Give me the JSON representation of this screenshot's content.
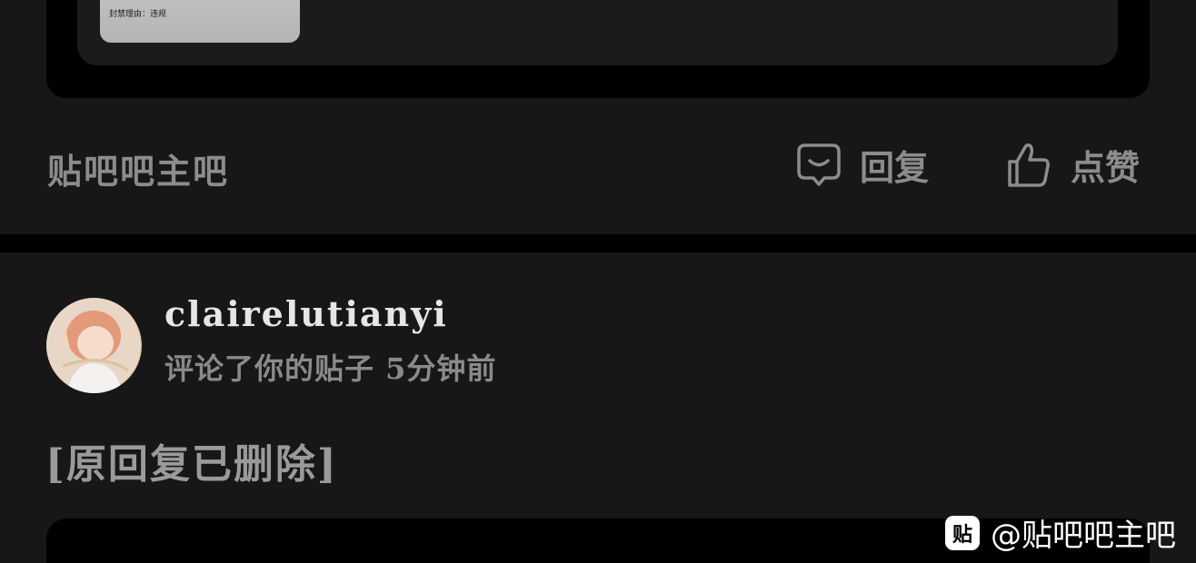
{
  "previous_post": {
    "ban_reason": "封禁理由：违规"
  },
  "action_bar": {
    "forum_name": "贴吧吧主吧",
    "reply_label": "回复",
    "like_label": "点赞"
  },
  "notification": {
    "username": "clairelutianyi",
    "meta": "评论了你的贴子 5分钟前",
    "content": "[原回复已删除]"
  },
  "watermark": {
    "logo_glyph": "贴",
    "text": "@贴吧吧主吧"
  },
  "icons": {
    "reply": "comment-bubble-icon",
    "like": "thumbs-up-icon"
  }
}
